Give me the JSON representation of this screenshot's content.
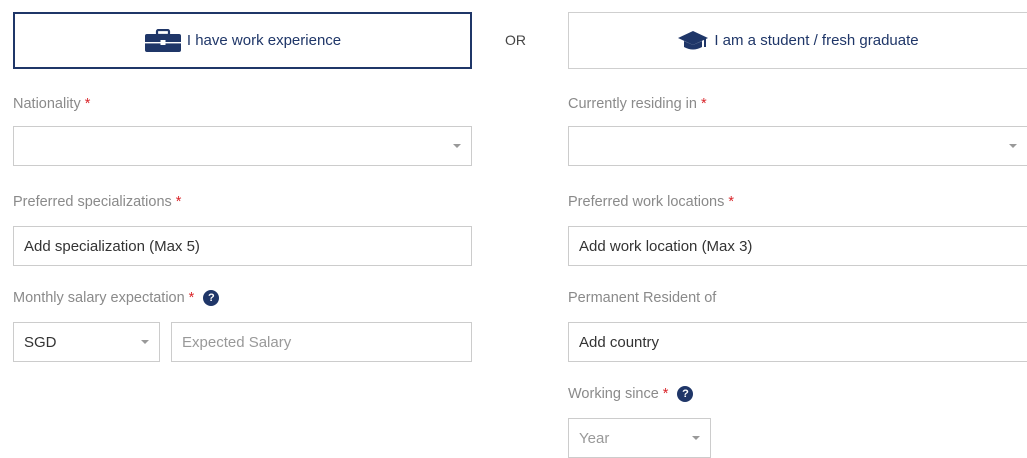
{
  "toggle": {
    "work_label": "I have work experience",
    "student_label": "I am a student / fresh graduate",
    "or_label": "OR",
    "work_icon": "briefcase-icon",
    "student_icon": "graduation-cap-icon"
  },
  "fields": {
    "nationality": {
      "label": "Nationality",
      "required": "*",
      "value": ""
    },
    "residing": {
      "label": "Currently residing in",
      "required": "*",
      "value": ""
    },
    "specializations": {
      "label": "Preferred specializations",
      "required": "*",
      "placeholder": "Add specialization (Max 5)"
    },
    "work_locations": {
      "label": "Preferred work locations",
      "required": "*",
      "placeholder": "Add work location (Max 3)"
    },
    "salary": {
      "label": "Monthly salary expectation",
      "required": "*",
      "help": "?",
      "currency": "SGD",
      "placeholder": "Expected Salary"
    },
    "permanent_resident": {
      "label": "Permanent Resident of",
      "placeholder": "Add country"
    },
    "working_since": {
      "label": "Working since",
      "required": "*",
      "help": "?",
      "year_placeholder": "Year"
    }
  },
  "colors": {
    "accent": "#1f3668",
    "required": "#d9252a",
    "label": "#8a8a8a",
    "border": "#cccccc"
  }
}
